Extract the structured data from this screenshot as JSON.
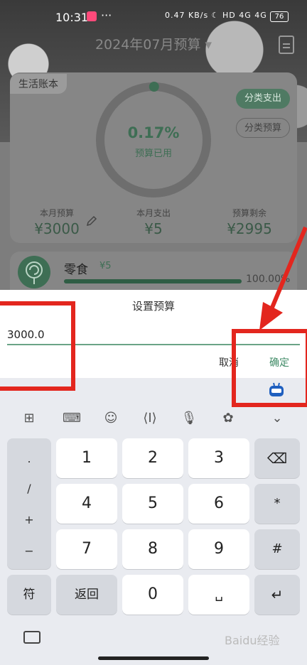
{
  "status_bar": {
    "time": "10:31",
    "dots": "···",
    "right": "0.47 KB/s ☾ HD 4G 4G",
    "battery": "76"
  },
  "header": {
    "title": "2024年07月预算 ▾"
  },
  "card": {
    "book_tag": "生活账本",
    "ring_percent": "0.17%",
    "ring_label": "预算已用",
    "btn_category_expense": "分类支出",
    "btn_category_budget": "分类预算",
    "stats": [
      {
        "label": "本月预算",
        "value": "¥3000"
      },
      {
        "label": "本月支出",
        "value": "¥5"
      },
      {
        "label": "预算剩余",
        "value": "¥2995"
      }
    ],
    "ring_used_fraction": 0.0017
  },
  "category": {
    "name": "零食",
    "amount": "¥5",
    "percent": "100.00%",
    "progress": 1.0
  },
  "dialog": {
    "title": "设置预算",
    "input_value": "3000.0",
    "cancel": "取消",
    "confirm": "确定"
  },
  "keyboard": {
    "toolbar_icons": [
      "grid-icon",
      "keyboard-icon",
      "emoji-icon",
      "cursor-icon",
      "mic-icon",
      "skin-icon",
      "collapse-icon"
    ],
    "side_keys": [
      ".",
      "/",
      "+",
      "−"
    ],
    "rows": [
      [
        "1",
        "2",
        "3"
      ],
      [
        "4",
        "5",
        "6"
      ],
      [
        "7",
        "8",
        "9"
      ]
    ],
    "right_keys": [
      "⌫",
      "*",
      "#",
      "↵"
    ],
    "symbol_key": "符",
    "back_key": "返回",
    "zero_key": "0",
    "space_key": "␣"
  },
  "watermark": "Baidu经验",
  "colors": {
    "accent": "#3e6e54",
    "annotation": "#e3261e"
  }
}
